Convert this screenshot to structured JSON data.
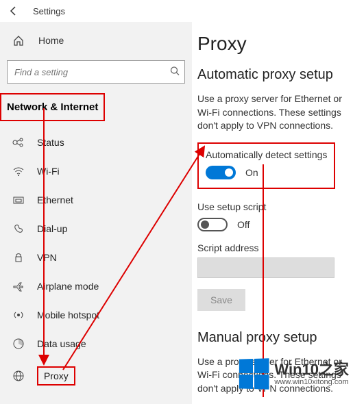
{
  "titlebar": {
    "title": "Settings"
  },
  "nav": {
    "home_label": "Home",
    "search_placeholder": "Find a setting",
    "section_header": "Network & Internet",
    "items": [
      {
        "label": "Status"
      },
      {
        "label": "Wi-Fi"
      },
      {
        "label": "Ethernet"
      },
      {
        "label": "Dial-up"
      },
      {
        "label": "VPN"
      },
      {
        "label": "Airplane mode"
      },
      {
        "label": "Mobile hotspot"
      },
      {
        "label": "Data usage"
      },
      {
        "label": "Proxy"
      }
    ]
  },
  "panel": {
    "page_title": "Proxy",
    "auto": {
      "header": "Automatic proxy setup",
      "desc": "Use a proxy server for Ethernet or Wi-Fi connections. These settings don't apply to VPN connections.",
      "autodetect_label": "Automatically detect settings",
      "autodetect_state": "On",
      "use_script_label": "Use setup script",
      "use_script_state": "Off",
      "script_address_label": "Script address",
      "save_label": "Save"
    },
    "manual": {
      "header": "Manual proxy setup",
      "desc": "Use a proxy server for Ethernet or Wi-Fi connections. These settings don't apply to VPN connections."
    }
  },
  "watermark": {
    "brand": "Win10之家",
    "url": "www.win10xitong.com"
  }
}
